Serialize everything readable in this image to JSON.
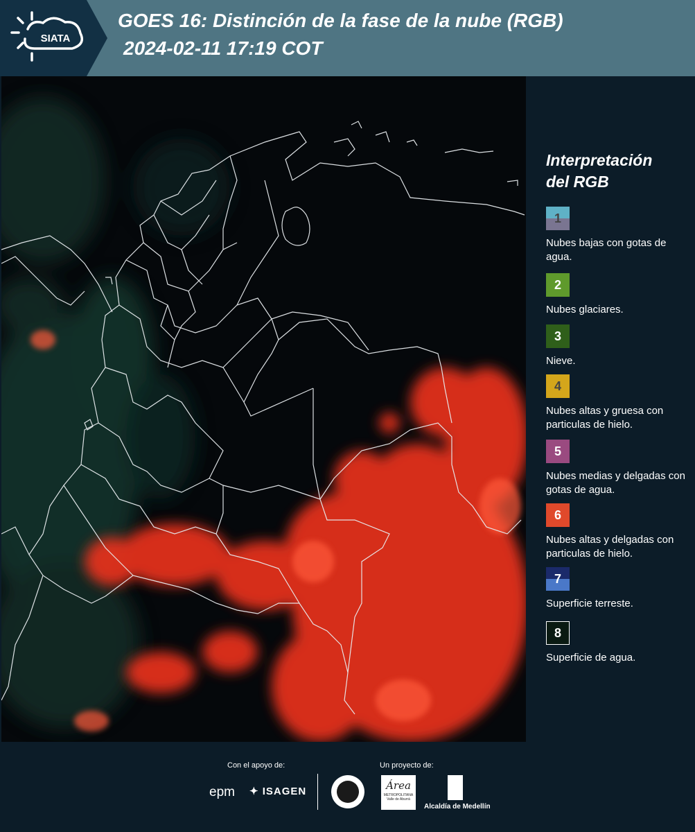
{
  "header": {
    "logo_text": "SIATA",
    "title_line1": "GOES 16: Distinción de la fase de la nube (RGB)",
    "title_line2": "2024-02-11 17:19 COT"
  },
  "legend": {
    "title_line1": "Interpretación",
    "title_line2": "del RGB",
    "items": [
      {
        "number": "1",
        "text": "Nubes bajas con gotas de agua.",
        "color": "#5fb1c6/#7a7591"
      },
      {
        "number": "2",
        "text": "Nubes glaciares.",
        "color": "#5f9a2c"
      },
      {
        "number": "3",
        "text": "Nieve.",
        "color": "#2f5f1a"
      },
      {
        "number": "4",
        "text": "Nubes altas y gruesa con particulas de hielo.",
        "color": "#d4a61b"
      },
      {
        "number": "5",
        "text": "Nubes medias y delgadas con gotas de agua.",
        "color": "#9a4a80"
      },
      {
        "number": "6",
        "text": "Nubes altas y delgadas con particulas de hielo.",
        "color": "#e0492b"
      },
      {
        "number": "7",
        "text": "Superficie terreste.",
        "color": "#1b2a6a/#4a78c8"
      },
      {
        "number": "8",
        "text": "Superficie de agua.",
        "color": "#0a1a12"
      }
    ]
  },
  "footer": {
    "support_label": "Con el apoyo de:",
    "project_label": "Un proyecto de:",
    "sponsor1": "epm",
    "sponsor2": "ISAGEN",
    "partner1_text": "Área",
    "partner1_sub": "METROPOLITANA",
    "partner1_sub2": "Valle de Aburrá",
    "partner2": "Alcaldía de Medellín"
  }
}
